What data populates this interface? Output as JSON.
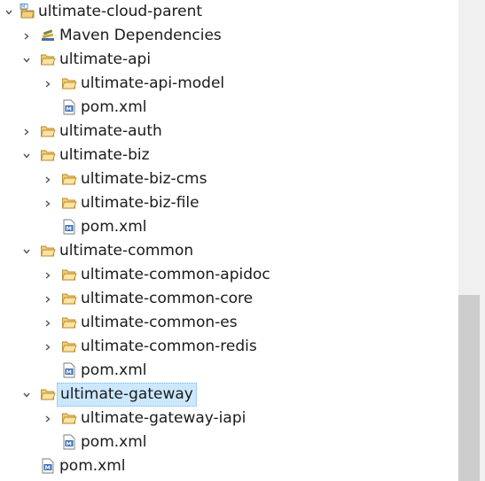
{
  "tree": {
    "root_label": "ultimate-cloud-parent",
    "maven_dependencies_label": "Maven Dependencies",
    "api": {
      "label": "ultimate-api",
      "model_label": "ultimate-api-model",
      "pom_label": "pom.xml"
    },
    "auth": {
      "label": "ultimate-auth"
    },
    "biz": {
      "label": "ultimate-biz",
      "cms_label": "ultimate-biz-cms",
      "file_label": "ultimate-biz-file",
      "pom_label": "pom.xml"
    },
    "common": {
      "label": "ultimate-common",
      "apidoc_label": "ultimate-common-apidoc",
      "core_label": "ultimate-common-core",
      "es_label": "ultimate-common-es",
      "redis_label": "ultimate-common-redis",
      "pom_label": "pom.xml"
    },
    "gateway": {
      "label": "ultimate-gateway",
      "iapi_label": "ultimate-gateway-iapi",
      "pom_label": "pom.xml"
    },
    "root_pom_label": "pom.xml"
  },
  "icons": {
    "folder_color": "#e8b84a",
    "pom_color": "#3b6fb5",
    "twisty_color": "#555555",
    "selection_color": "#cce8ff"
  }
}
